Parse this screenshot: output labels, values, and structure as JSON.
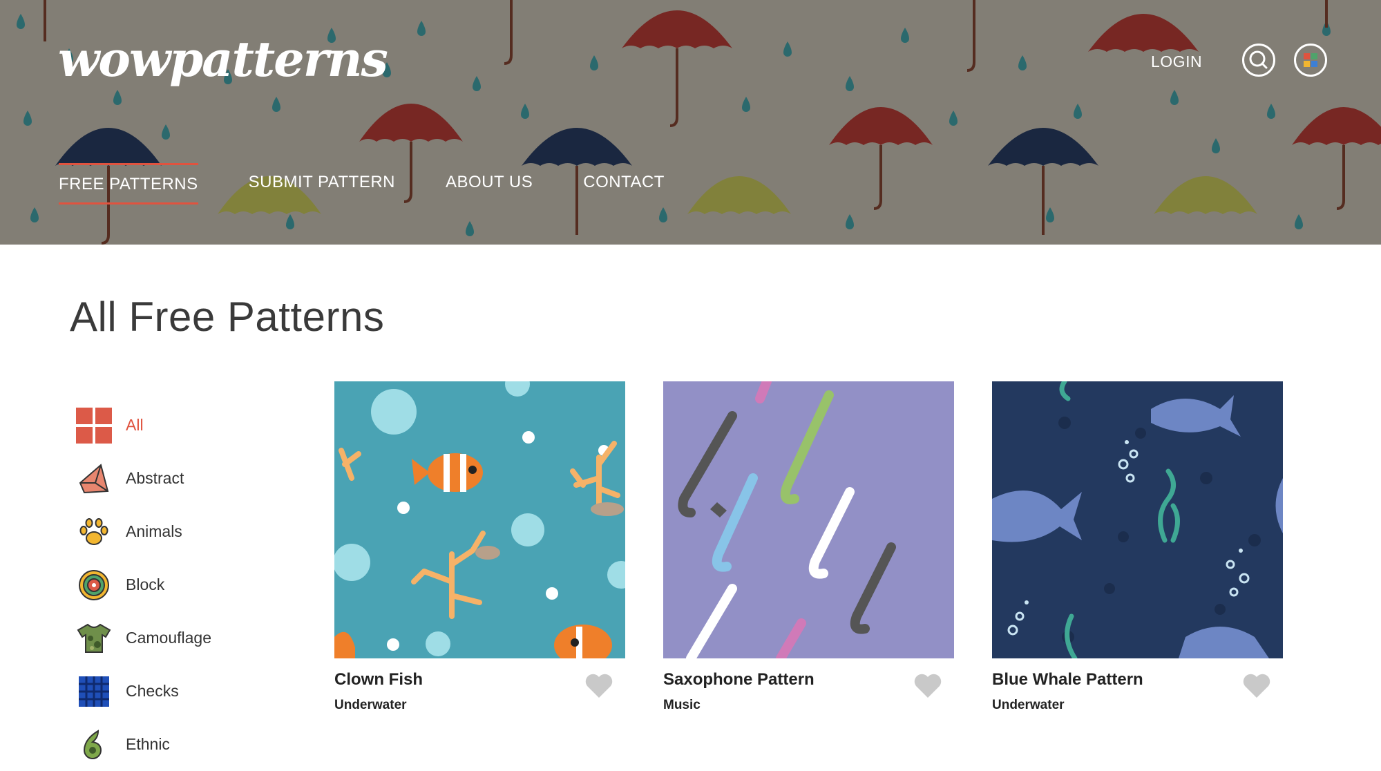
{
  "header": {
    "logo": "wowpatterns",
    "login_label": "LOGIN",
    "nav": [
      {
        "label": "FREE PATTERNS",
        "active": true
      },
      {
        "label": "SUBMIT PATTERN",
        "active": false
      },
      {
        "label": "ABOUT US",
        "active": false
      },
      {
        "label": "CONTACT",
        "active": false
      }
    ],
    "icons": [
      "search-icon",
      "apps-menu-icon"
    ]
  },
  "main": {
    "title": "All Free Patterns"
  },
  "sidebar": {
    "categories": [
      {
        "label": "All",
        "icon": "grid-icon",
        "active": true
      },
      {
        "label": "Abstract",
        "icon": "abstract-shape-icon",
        "active": false
      },
      {
        "label": "Animals",
        "icon": "paw-icon",
        "active": false
      },
      {
        "label": "Block",
        "icon": "block-mandala-icon",
        "active": false
      },
      {
        "label": "Camouflage",
        "icon": "camouflage-shirt-icon",
        "active": false
      },
      {
        "label": "Checks",
        "icon": "checks-icon",
        "active": false
      },
      {
        "label": "Ethnic",
        "icon": "paisley-icon",
        "active": false
      }
    ]
  },
  "cards": [
    {
      "title": "Clown Fish",
      "category": "Underwater",
      "bg": "#4aa3b4"
    },
    {
      "title": "Saxophone Pattern",
      "category": "Music",
      "bg": "#9290c6"
    },
    {
      "title": "Blue Whale Pattern",
      "category": "Underwater",
      "bg": "#23395f"
    }
  ],
  "colors": {
    "accent": "#e0533f",
    "header_bg": "#8a857c",
    "heart": "#c9c9c9"
  }
}
